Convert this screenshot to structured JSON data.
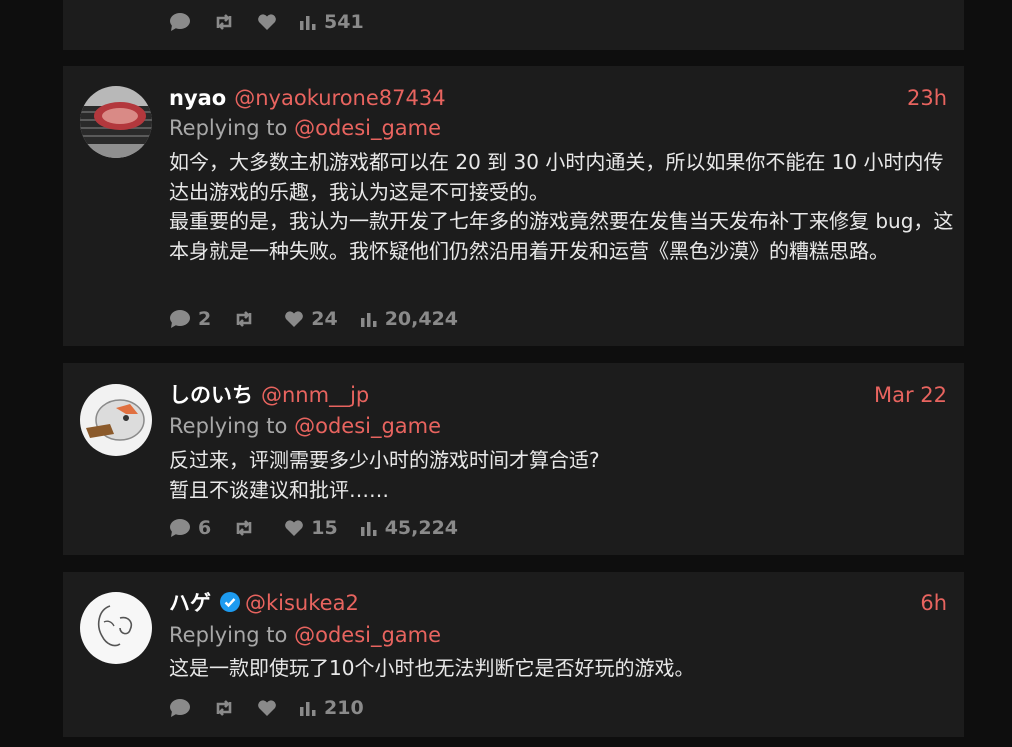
{
  "colors": {
    "accent": "#e8645f",
    "card_bg": "#1c1c1c",
    "page_bg": "#0e0e0e",
    "verified": "#1d9bf0"
  },
  "top_card": {
    "views": "541"
  },
  "tweets": [
    {
      "display_name": "nyao",
      "handle": "@nyaokurone87434",
      "time": "23h",
      "reply_prefix": "Replying to",
      "reply_to": "@odesi_game",
      "body": [
        "如今，大多数主机游戏都可以在 20 到 30 小时内通关，所以如果你不能在 10 小时内传达出游戏的乐趣，我认为这是不可接受的。",
        "最重要的是，我认为一款开发了七年多的游戏竟然要在发售当天发布补丁来修复 bug，这本身就是一种失败。我怀疑他们仍然沿用着开发和运营《黑色沙漠》的糟糕思路。"
      ],
      "replies": "2",
      "retweets": "",
      "likes": "24",
      "views": "20,424"
    },
    {
      "display_name": "しのいち",
      "handle": "@nnm__jp",
      "time": "Mar 22",
      "reply_prefix": "Replying to",
      "reply_to": "@odesi_game",
      "body": [
        "反过来，评测需要多少小时的游戏时间才算合适?",
        "暂且不谈建议和批评……"
      ],
      "replies": "6",
      "retweets": "",
      "likes": "15",
      "views": "45,224"
    },
    {
      "display_name": "ハゲ",
      "handle": "@kisukea2",
      "time": "6h",
      "verified": true,
      "reply_prefix": "Replying to",
      "reply_to": "@odesi_game",
      "body": [
        "这是一款即使玩了10个小时也无法判断它是否好玩的游戏。"
      ],
      "replies": "",
      "retweets": "",
      "likes": "",
      "views": "210"
    }
  ]
}
